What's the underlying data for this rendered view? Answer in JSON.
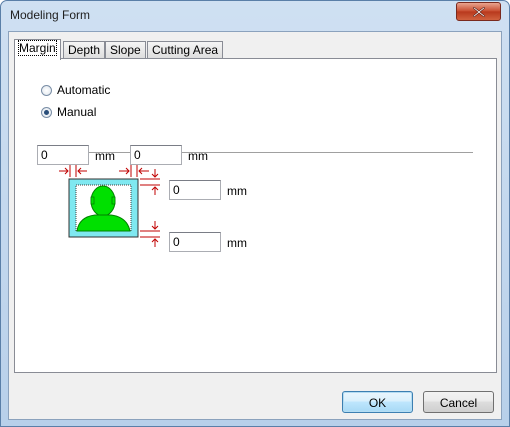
{
  "window": {
    "title": "Modeling Form"
  },
  "tabs": [
    {
      "label": "Margin",
      "selected": true
    },
    {
      "label": "Depth",
      "selected": false
    },
    {
      "label": "Slope",
      "selected": false
    },
    {
      "label": "Cutting Area",
      "selected": false
    }
  ],
  "mode": {
    "options": [
      {
        "label": "Automatic",
        "checked": false
      },
      {
        "label": "Manual",
        "checked": true
      }
    ]
  },
  "margins": {
    "left": {
      "value": "0",
      "unit": "mm"
    },
    "right": {
      "value": "0",
      "unit": "mm"
    },
    "top": {
      "value": "0",
      "unit": "mm"
    },
    "bottom": {
      "value": "0",
      "unit": "mm"
    }
  },
  "buttons": {
    "ok": "OK",
    "cancel": "Cancel"
  },
  "colors": {
    "preview_bg": "#7fe8f0",
    "figure": "#00e000",
    "arrows": "#c00000"
  },
  "icons": {
    "close": "close-icon",
    "portrait": "portrait-icon"
  }
}
